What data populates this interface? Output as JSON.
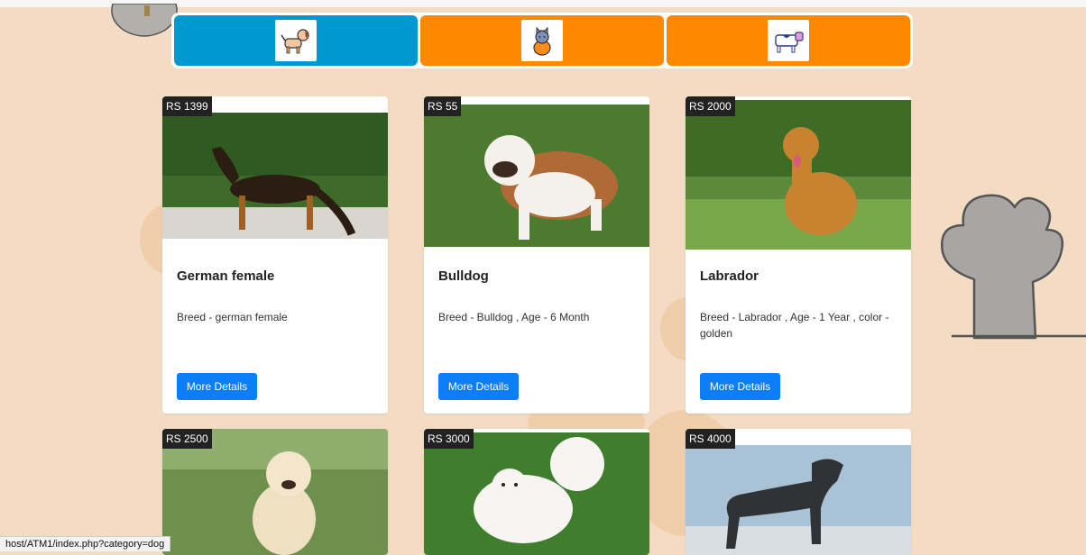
{
  "colors": {
    "background": "#f3dcc3",
    "tab_active": "#0098d1",
    "tab_inactive": "#ff8800",
    "button": "#0d7ef7"
  },
  "categories": [
    {
      "name": "dog-tab",
      "icon": "dog-icon",
      "active": true
    },
    {
      "name": "cat-tab",
      "icon": "cat-icon",
      "active": false
    },
    {
      "name": "cow-tab",
      "icon": "cow-icon",
      "active": false
    }
  ],
  "pets": [
    {
      "price": "RS 1399",
      "title": "German female",
      "description": "Breed - german female",
      "button": "More Details"
    },
    {
      "price": "RS 55",
      "title": "Bulldog",
      "description": "Breed - Bulldog , Age - 6 Month",
      "button": "More Details"
    },
    {
      "price": "RS 2000",
      "title": "Labrador",
      "description": "Breed - Labrador , Age - 1 Year , color - golden",
      "button": "More Details"
    },
    {
      "price": "RS 2500"
    },
    {
      "price": "RS 3000"
    },
    {
      "price": "RS 4000"
    }
  ],
  "status_url": "host/ATM1/index.php?category=dog"
}
